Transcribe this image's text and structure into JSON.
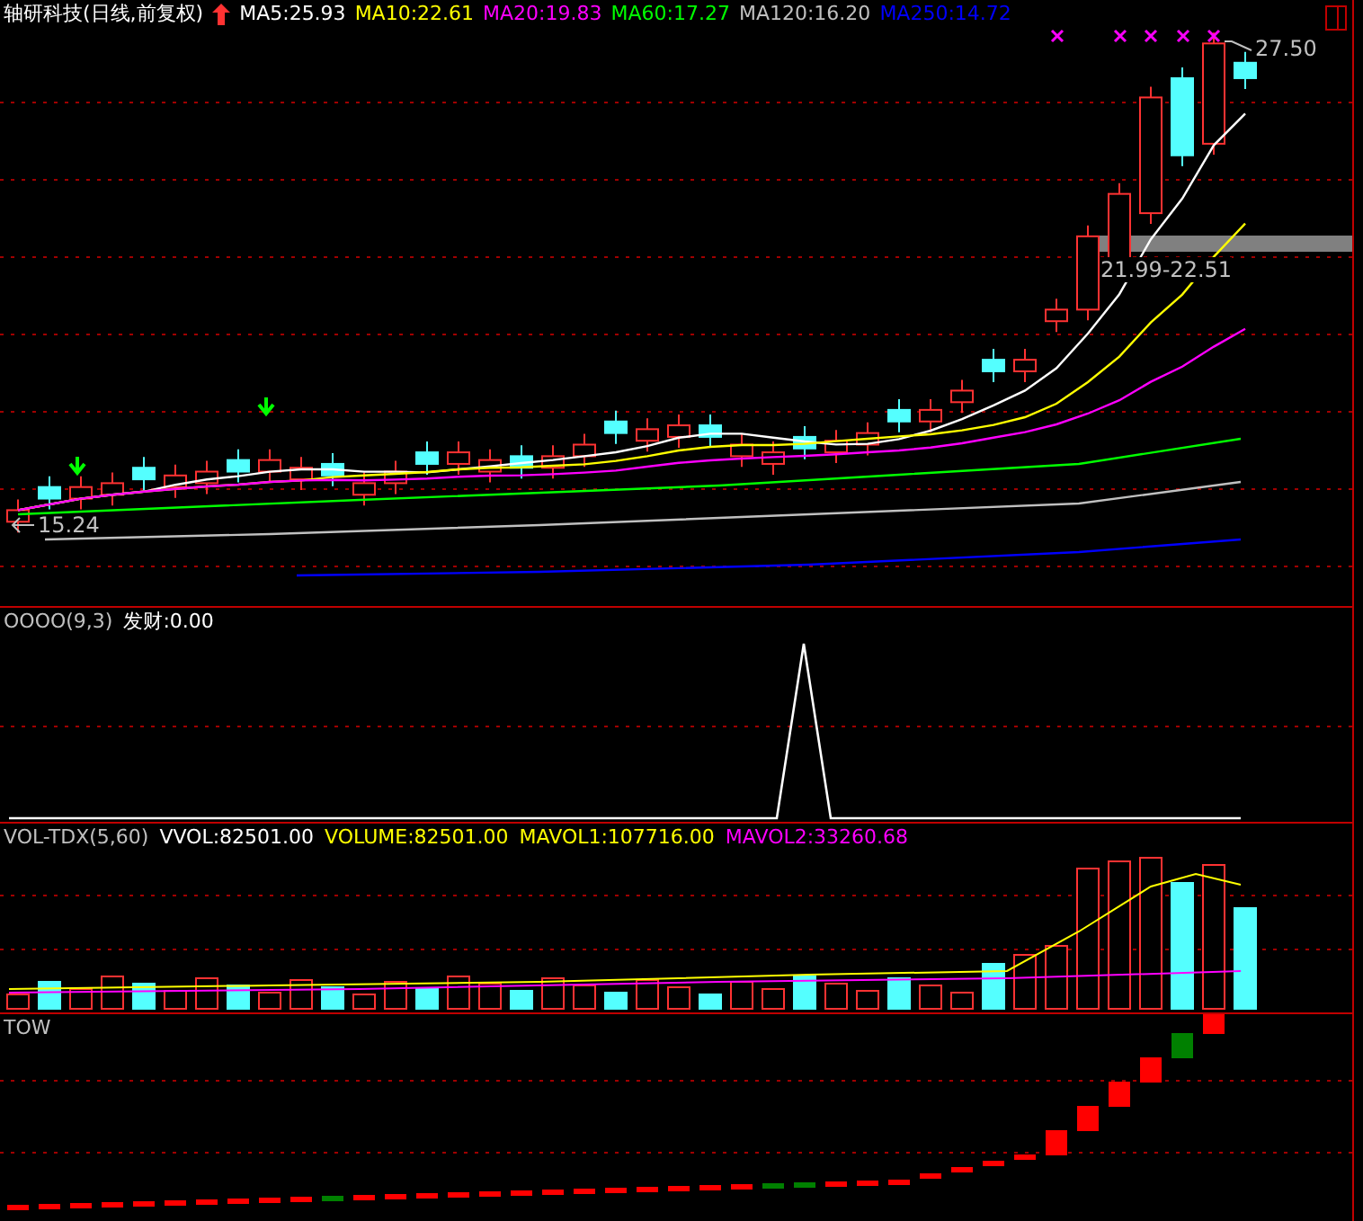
{
  "title": "轴研科技(日线,前复权)",
  "ma_legend": [
    {
      "label": "MA5:25.93",
      "color": "#ffffff"
    },
    {
      "label": "MA10:22.61",
      "color": "#ffff00"
    },
    {
      "label": "MA20:19.83",
      "color": "#ff00ff"
    },
    {
      "label": "MA60:17.27",
      "color": "#00ff00"
    },
    {
      "label": "MA120:16.20",
      "color": "#c0c0c0"
    },
    {
      "label": "MA250:14.72",
      "color": "#0000ff"
    }
  ],
  "price_labels": {
    "high": "27.50",
    "low": "15.24",
    "range": "21.99-22.51"
  },
  "indicator": {
    "name": "OOOO(9,3)",
    "value": "发财:0.00"
  },
  "volume": {
    "legend": [
      {
        "label": "VOL-TDX(5,60)",
        "color": "#c0c0c0"
      },
      {
        "label": "VVOL:82501.00",
        "color": "#ffffff"
      },
      {
        "label": "VOLUME:82501.00",
        "color": "#ffff00"
      },
      {
        "label": "MAVOL1:107716.00",
        "color": "#ffff00"
      },
      {
        "label": "MAVOL2:33260.68",
        "color": "#ff00ff"
      }
    ]
  },
  "tow": {
    "name": "TOW"
  }
}
